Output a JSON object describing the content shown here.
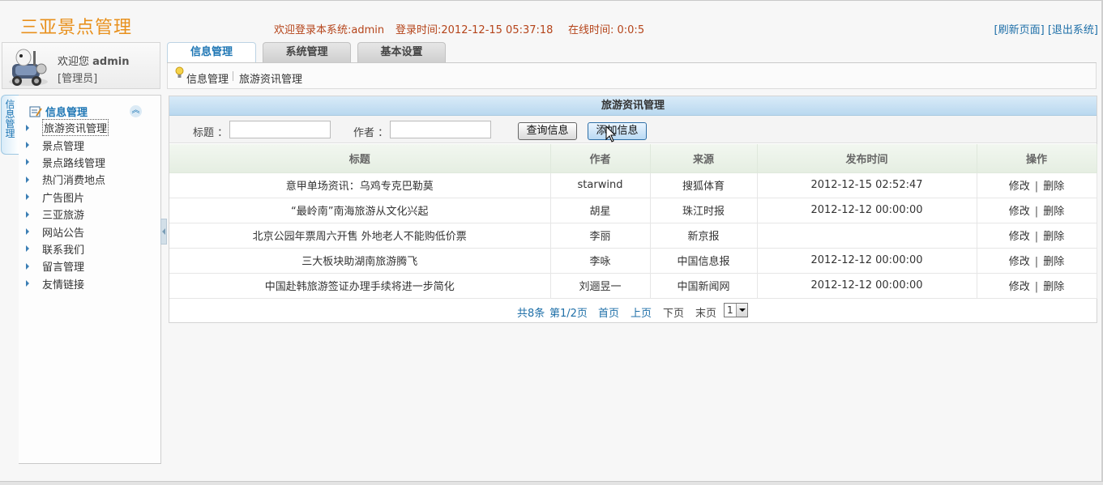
{
  "app": {
    "title": "三亚景点管理"
  },
  "header": {
    "welcome": "欢迎登录本系统:admin",
    "login_time": "登录时间:2012-12-15 05:37:18",
    "online_time": "在线时间: 0:0:5",
    "refresh_label": "[刷新页面]",
    "logout_label": "[退出系统]"
  },
  "user": {
    "greeting": "欢迎您",
    "name": "admin",
    "role": "[管理员]"
  },
  "sidebar": {
    "tab_label": [
      "信",
      "息",
      "管",
      "理"
    ],
    "group_title": "信息管理",
    "items": [
      {
        "label": "旅游资讯管理"
      },
      {
        "label": "景点管理"
      },
      {
        "label": "景点路线管理"
      },
      {
        "label": "热门消费地点"
      },
      {
        "label": "广告图片"
      },
      {
        "label": "三亚旅游"
      },
      {
        "label": "网站公告"
      },
      {
        "label": "联系我们"
      },
      {
        "label": "留言管理"
      },
      {
        "label": "友情链接"
      }
    ]
  },
  "tabs": [
    {
      "label": "信息管理"
    },
    {
      "label": "系统管理"
    },
    {
      "label": "基本设置"
    }
  ],
  "breadcrumb": {
    "item1": "信息管理",
    "item2": "旅游资讯管理"
  },
  "panel": {
    "title": "旅游资讯管理",
    "search": {
      "title_label": "标题 ：",
      "author_label": "作者 ：",
      "title_value": "",
      "author_value": "",
      "query_button": "查询信息",
      "add_button": "添加信息"
    },
    "columns": [
      "标题",
      "作者",
      "来源",
      "发布时间",
      "操作"
    ],
    "rows": [
      {
        "title": "意甲单场资讯：乌鸡专克巴勒莫",
        "author": "starwind",
        "source": "搜狐体育",
        "time": "2012-12-15 02:52:47"
      },
      {
        "title": "“最岭南”南海旅游从文化兴起",
        "author": "胡星",
        "source": "珠江时报",
        "time": "2012-12-12 00:00:00"
      },
      {
        "title": "北京公园年票周六开售 外地老人不能购低价票",
        "author": "李丽",
        "source": "新京报",
        "time": ""
      },
      {
        "title": "三大板块助湖南旅游腾飞",
        "author": "李咏",
        "source": "中国信息报",
        "time": "2012-12-12 00:00:00"
      },
      {
        "title": "中国赴韩旅游签证办理手续将进一步简化",
        "author": "刘逦昱一",
        "source": "中国新闻网",
        "time": "2012-12-12 00:00:00"
      }
    ],
    "edit_label": "修改",
    "delete_label": "删除",
    "pager": {
      "total": "共8条",
      "page": "第1/2页",
      "first": "首页",
      "prev": "上页",
      "next": "下页",
      "last": "末页",
      "current": "1"
    }
  },
  "colors": {
    "accent": "#1e76b4",
    "logo": "#e8901c",
    "header_text": "#b5441a"
  }
}
